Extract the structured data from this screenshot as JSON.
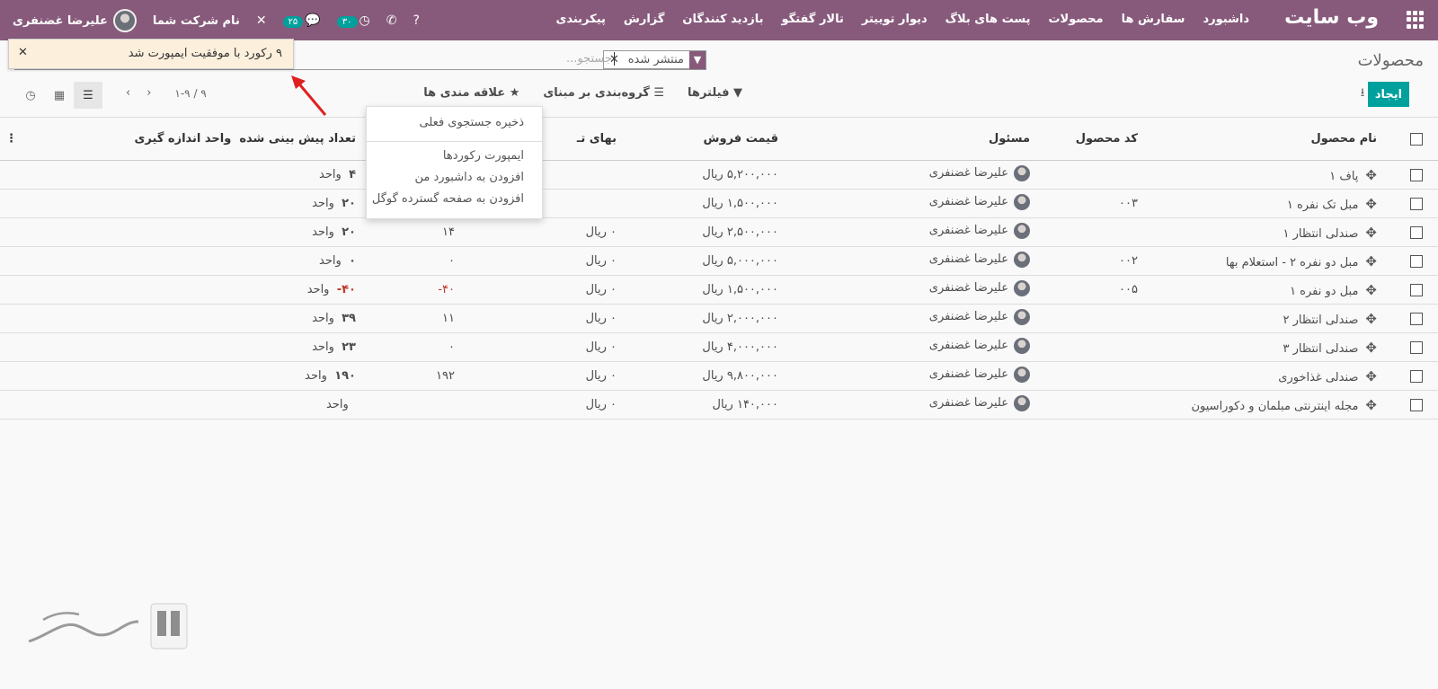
{
  "topbar": {
    "brand": "وب سایت",
    "menu": [
      "داشبورد",
      "سفارش ها",
      "محصولات",
      "پست های بلاگ",
      "دیوار توییتر",
      "تالار گفتگو",
      "بازدید کنندگان",
      "گزارش",
      "پیکربندی"
    ],
    "company": "نام شرکت شما",
    "user_name": "علیرضا غضنفری",
    "messages_count": "۲۵",
    "activities_count": "۳۰"
  },
  "breadcrumb": "محصولات",
  "search": {
    "facet_value": "منتشر شده",
    "placeholder": "جستجو..."
  },
  "toolbar": {
    "create_label": "ایجاد",
    "filters_label": "فیلترها",
    "groupby_label": "گروه‌بندی بر مبنای",
    "favorites_label": "علاقه مندی ها"
  },
  "pager": {
    "value": "۱-۹ / ۹"
  },
  "toast": {
    "message": "۹ رکورد با موفقیت ایمپورت شد"
  },
  "dropdown": {
    "items": [
      "ذخیره جستجوی فعلی",
      "ایمپورت رکوردها",
      "افزودن به داشبورد من",
      "افزودن به صفحه گسترده گوگل"
    ]
  },
  "columns": {
    "name": "نام محصول",
    "code": "کد محصول",
    "owner": "مسئول",
    "price": "قیمت فروش",
    "cost": "بهای تـ",
    "forecast": "تعداد پیش بینی شده",
    "uom": "واحد اندازه گیری"
  },
  "rows": [
    {
      "name": "پاف ۱",
      "code": "",
      "owner": "علیرضا غضنفری",
      "price": "۵,۲۰۰,۰۰۰ ریال",
      "cost": "",
      "onhand": "",
      "forecast": "۴",
      "uom": "واحد"
    },
    {
      "name": "مبل تک نفره ۱",
      "code": "۰۰۳",
      "owner": "علیرضا غضنفری",
      "price": "۱,۵۰۰,۰۰۰ ریال",
      "cost": "",
      "onhand": "",
      "forecast": "۲۰",
      "uom": "واحد"
    },
    {
      "name": "صندلی انتظار ۱",
      "code": "",
      "owner": "علیرضا غضنفری",
      "price": "۲,۵۰۰,۰۰۰ ریال",
      "cost": "۰ ریال",
      "onhand": "۱۴",
      "forecast": "۲۰",
      "uom": "واحد"
    },
    {
      "name": "مبل دو نفره ۲ - استعلام بها",
      "code": "۰۰۲",
      "owner": "علیرضا غضنفری",
      "price": "۵,۰۰۰,۰۰۰ ریال",
      "cost": "۰ ریال",
      "onhand": "۰",
      "forecast": "۰",
      "uom": "واحد"
    },
    {
      "name": "مبل دو نفره ۱",
      "code": "۰۰۵",
      "owner": "علیرضا غضنفری",
      "price": "۱,۵۰۰,۰۰۰ ریال",
      "cost": "۰ ریال",
      "onhand": "۴۰-",
      "forecast": "۴۰-",
      "uom": "واحد"
    },
    {
      "name": "صندلی انتظار ۲",
      "code": "",
      "owner": "علیرضا غضنفری",
      "price": "۲,۰۰۰,۰۰۰ ریال",
      "cost": "۰ ریال",
      "onhand": "۱۱",
      "forecast": "۳۹",
      "uom": "واحد"
    },
    {
      "name": "صندلی انتظار ۳",
      "code": "",
      "owner": "علیرضا غضنفری",
      "price": "۴,۰۰۰,۰۰۰ ریال",
      "cost": "۰ ریال",
      "onhand": "۰",
      "forecast": "۲۳",
      "uom": "واحد"
    },
    {
      "name": "صندلی غذاخوری",
      "code": "",
      "owner": "علیرضا غضنفری",
      "price": "۹,۸۰۰,۰۰۰ ریال",
      "cost": "۰ ریال",
      "onhand": "۱۹۲",
      "forecast": "۱۹۰",
      "uom": "واحد"
    },
    {
      "name": "مجله اینترنتی مبلمان و دکوراسیون",
      "code": "",
      "owner": "علیرضا غضنفری",
      "price": "۱۴۰,۰۰۰ ریال",
      "cost": "۰ ریال",
      "onhand": "",
      "forecast": "",
      "uom": "واحد"
    }
  ],
  "colors": {
    "brand": "#875a7b",
    "primary": "#00a09d",
    "danger": "#c0392b"
  }
}
